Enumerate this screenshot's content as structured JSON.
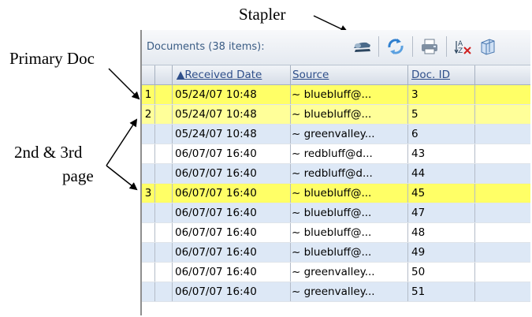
{
  "annotations": {
    "stapler": "Stapler",
    "primary_doc": "Primary Doc",
    "second_third_line1": "2nd & 3rd",
    "second_third_line2": "page"
  },
  "toolbar": {
    "title": "Documents (38 items):",
    "icons": [
      "stapler-icon",
      "refresh-icon",
      "print-icon",
      "spell-check-icon",
      "columns-icon"
    ]
  },
  "columns": {
    "date": "▲Received Date",
    "source": "Source",
    "doc_id": "Doc. ID"
  },
  "rows": [
    {
      "idx": "1",
      "date": "05/24/07 10:48",
      "source": "~ bluebluff@...",
      "doc_id": "3",
      "highlight": "yellow"
    },
    {
      "idx": "2",
      "date": "05/24/07 10:48",
      "source": "~ bluebluff@...",
      "doc_id": "5",
      "highlight": "pyellow"
    },
    {
      "idx": "",
      "date": "05/24/07 10:48",
      "source": "~ greenvalley...",
      "doc_id": "6",
      "highlight": "blue"
    },
    {
      "idx": "",
      "date": "06/07/07 16:40",
      "source": "~ redbluff@d...",
      "doc_id": "43",
      "highlight": "white"
    },
    {
      "idx": "",
      "date": "06/07/07 16:40",
      "source": "~ redbluff@d...",
      "doc_id": "44",
      "highlight": "blue"
    },
    {
      "idx": "3",
      "date": "06/07/07 16:40",
      "source": "~ bluebluff@...",
      "doc_id": "45",
      "highlight": "yellow"
    },
    {
      "idx": "",
      "date": "06/07/07 16:40",
      "source": "~ bluebluff@...",
      "doc_id": "47",
      "highlight": "blue"
    },
    {
      "idx": "",
      "date": "06/07/07 16:40",
      "source": "~ bluebluff@...",
      "doc_id": "48",
      "highlight": "white"
    },
    {
      "idx": "",
      "date": "06/07/07 16:40",
      "source": "~ bluebluff@...",
      "doc_id": "49",
      "highlight": "blue"
    },
    {
      "idx": "",
      "date": "06/07/07 16:40",
      "source": "~ greenvalley...",
      "doc_id": "50",
      "highlight": "white"
    },
    {
      "idx": "",
      "date": "06/07/07 16:40",
      "source": "~ greenvalley...",
      "doc_id": "51",
      "highlight": "blue"
    }
  ],
  "colors": {
    "highlight_yellow": "#ffff66",
    "row_blue": "#dde8f6",
    "header_link": "#2f4f8a"
  }
}
